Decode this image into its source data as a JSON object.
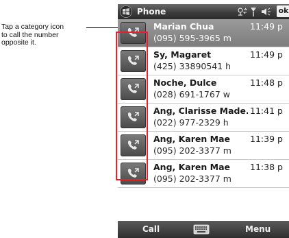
{
  "callout": {
    "line1": "Tap a category icon",
    "line2": "to call the number",
    "line3": "opposite it."
  },
  "titlebar": {
    "title": "Phone",
    "ok_label": "ok",
    "icons": [
      "windows-start-icon",
      "connectivity-icon",
      "signal-icon",
      "volume-icon"
    ]
  },
  "calls": [
    {
      "name": "Marian Chua",
      "time": "11:49 p",
      "number": "(095) 595-3965 m",
      "selected": true
    },
    {
      "name": "Sy, Magaret",
      "time": "11:49 p",
      "number": "(425) 33890541 h",
      "selected": false
    },
    {
      "name": "Noche, Dulce",
      "time": "11:48 p",
      "number": "(028) 691-1767 w",
      "selected": false
    },
    {
      "name": "Ang, Clarisse Made...",
      "time": "11:41 p",
      "number": "(022) 977-2329 h",
      "selected": false
    },
    {
      "name": "Ang, Karen Mae",
      "time": "11:39 p",
      "number": "(095) 202-3377 m",
      "selected": false
    },
    {
      "name": "Ang, Karen Mae",
      "time": "11:38 p",
      "number": "(095) 202-3377 m",
      "selected": false
    }
  ],
  "softkeys": {
    "left": "Call",
    "right": "Menu",
    "center_icon": "keyboard-icon"
  },
  "colors": {
    "highlight": "#e8202a",
    "titlebar": "#3d3d3d",
    "selected_row": "#8a8a8a"
  }
}
